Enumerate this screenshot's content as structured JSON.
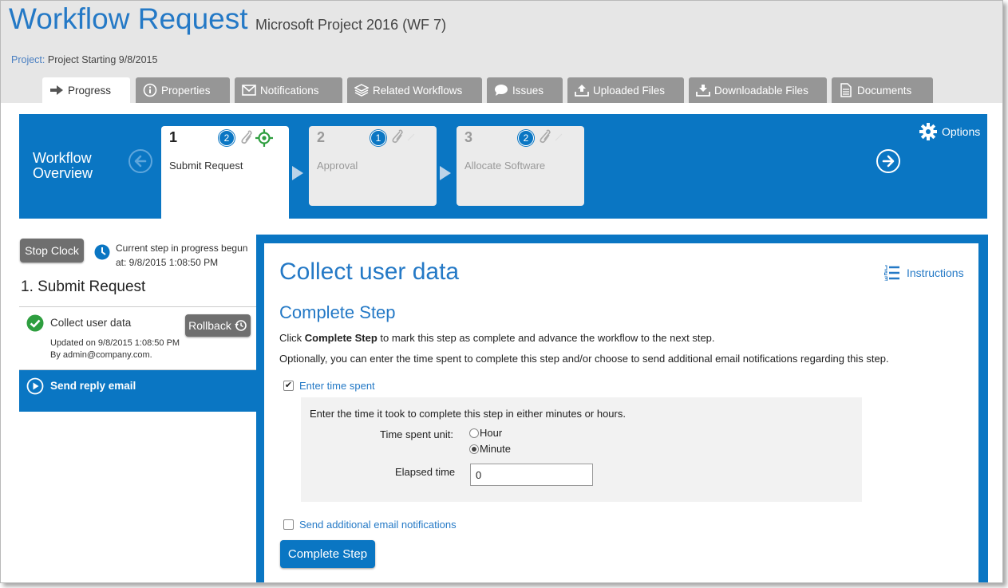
{
  "header": {
    "title": "Workflow Request",
    "subtitle": "Microsoft Project 2016 (WF 7)",
    "project_label": "Project:",
    "project_value": "Project Starting 9/8/2015"
  },
  "tabs": [
    {
      "label": "Progress",
      "icon": "arrow-right-icon",
      "active": true
    },
    {
      "label": "Properties",
      "icon": "info-icon",
      "active": false
    },
    {
      "label": "Notifications",
      "icon": "envelope-icon",
      "active": false
    },
    {
      "label": "Related Workflows",
      "icon": "layers-icon",
      "active": false
    },
    {
      "label": "Issues",
      "icon": "speech-bubble-icon",
      "active": false
    },
    {
      "label": "Uploaded Files",
      "icon": "upload-icon",
      "active": false
    },
    {
      "label": "Downloadable Files",
      "icon": "download-icon",
      "active": false
    },
    {
      "label": "Documents",
      "icon": "document-icon",
      "active": false
    }
  ],
  "workflow": {
    "title_line1": "Workflow",
    "title_line2": "Overview",
    "options_label": "Options",
    "steps": [
      {
        "number": "1",
        "name": "Submit Request",
        "badge": "2",
        "active": true
      },
      {
        "number": "2",
        "name": "Approval",
        "badge": "1",
        "active": false
      },
      {
        "number": "3",
        "name": "Allocate Software",
        "badge": "2",
        "active": false
      }
    ]
  },
  "left": {
    "stop_clock": "Stop Clock",
    "clock_line1": "Current step in progress begun",
    "clock_line2": "at: 9/8/2015 1:08:50 PM",
    "step_heading": "1. Submit Request",
    "task_name": "Collect user data",
    "rollback": "Rollback",
    "updated": "Updated on 9/8/2015 1:08:50 PM",
    "by": "By admin@company.com.",
    "next_task": "Send reply email"
  },
  "main": {
    "title": "Collect user data",
    "instructions": "Instructions",
    "section_title": "Complete Step",
    "para1_prefix": "Click ",
    "para1_bold": "Complete Step",
    "para1_suffix": " to mark this step as complete and advance the workflow to the next step.",
    "para2": "Optionally, you can enter the time spent to complete this step and/or choose to send additional email notifications regarding this step.",
    "enter_time_label": "Enter time spent",
    "enter_time_checked": true,
    "time_desc": "Enter the time it took to complete this step in either minutes or hours.",
    "unit_label": "Time spent unit:",
    "unit_hour": "Hour",
    "unit_minute": "Minute",
    "unit_selected": "Minute",
    "elapsed_label": "Elapsed time",
    "elapsed_value": "0",
    "send_email_label": "Send additional email notifications",
    "send_email_checked": false,
    "complete_button": "Complete Step"
  },
  "colors": {
    "accent_blue": "#0a76c3",
    "title_blue": "#2479c6",
    "tab_gray": "#969696",
    "success_green": "#2e9e3f"
  }
}
